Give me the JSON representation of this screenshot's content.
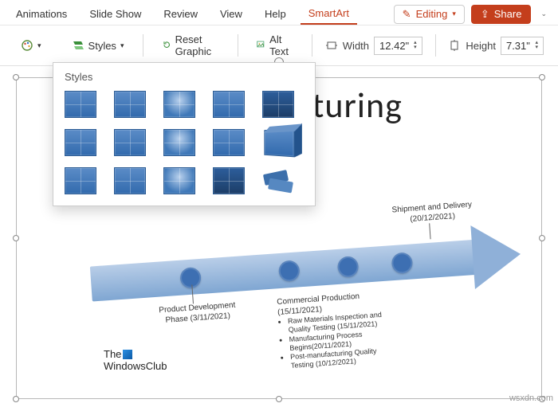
{
  "tabs": {
    "animations": "Animations",
    "slideshow": "Slide Show",
    "review": "Review",
    "view": "View",
    "help": "Help",
    "smartart": "SmartArt"
  },
  "top_right": {
    "editing": "Editing",
    "share": "Share"
  },
  "ribbon": {
    "styles": "Styles",
    "reset_graphic": "Reset Graphic",
    "alt_text": "Alt Text",
    "width_label": "Width",
    "width_value": "12.42\"",
    "height_label": "Height",
    "height_value": "7.31\""
  },
  "flyout": {
    "heading": "Styles",
    "items": [
      "simple-fill",
      "white-border",
      "subtle-effect",
      "moderate-effect",
      "intense-effect",
      "polished",
      "inset",
      "cartoon",
      "powder",
      "brick",
      "flat-scene",
      "bevel",
      "metallic",
      "sunset",
      "3d-block"
    ]
  },
  "slide": {
    "title_fragment": "acturing",
    "timeline": {
      "node1": {
        "title": "Product Development",
        "sub": "Phase (3/11/2021)"
      },
      "node2": {
        "title": "Commercial Production",
        "sub": "(15/11/2021)",
        "bullets": [
          "Raw Materials Inspection and Quality Testing (15/11/2021)",
          "Manufacturing Process Begins(20/11/2021)",
          "Post-manufacturing Quality Testing (10/12/2021)"
        ]
      },
      "node3": {
        "title": "Shipment and Delivery",
        "sub": "(20/12/2021)"
      }
    },
    "logo_line1": "The",
    "logo_line2": "WindowsClub"
  },
  "watermark": "wsxdn.com"
}
